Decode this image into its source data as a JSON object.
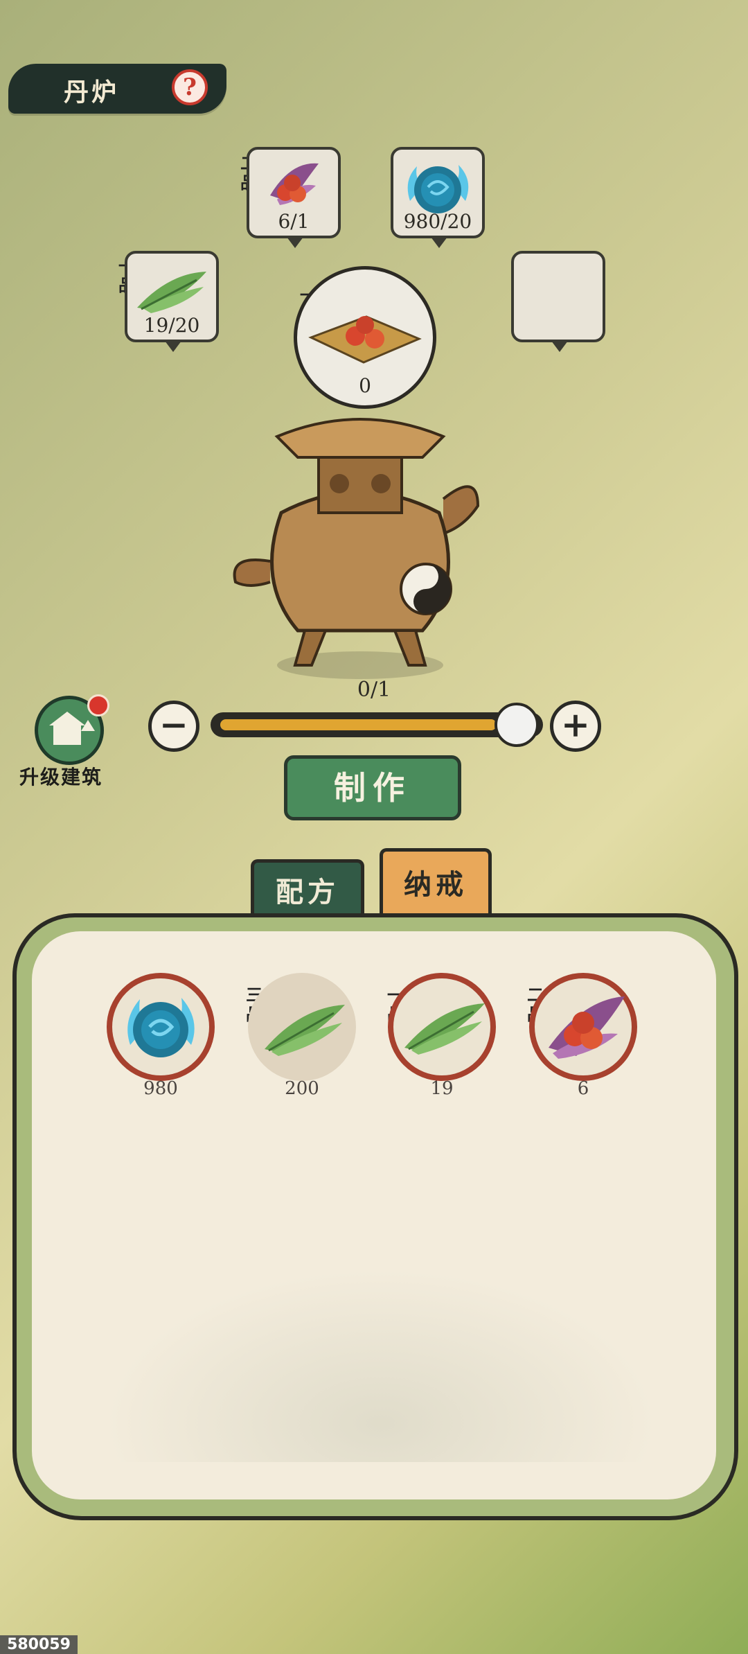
{
  "header": {
    "title": "丹炉",
    "help_icon": "?"
  },
  "ingredients": [
    {
      "grade": "二品",
      "icon": "berry-herb-icon",
      "count": "6/1"
    },
    {
      "grade": "",
      "icon": "spirit-orb-icon",
      "count": "980/20"
    },
    {
      "grade": "一品",
      "icon": "leaf-herb-icon",
      "count": "19/20"
    },
    {
      "grade": "",
      "icon": "",
      "count": ""
    }
  ],
  "product": {
    "grade": "一品",
    "icon": "pill-icon",
    "count": "0"
  },
  "progress": {
    "label": "0/1",
    "slider_fraction": 0.95
  },
  "controls": {
    "minus": "−",
    "plus": "+"
  },
  "upgrade": {
    "label": "升级建筑"
  },
  "make_button": {
    "label": "制作"
  },
  "tabs": [
    {
      "label": "配方",
      "active": false
    },
    {
      "label": "纳戒",
      "active": true
    }
  ],
  "inventory": [
    {
      "grade": "",
      "icon": "spirit-orb-icon",
      "count": "980"
    },
    {
      "grade": "三品",
      "icon": "leaf-herb-icon",
      "count": "200"
    },
    {
      "grade": "一品",
      "icon": "leaf-herb-icon",
      "count": "19"
    },
    {
      "grade": "二品",
      "icon": "berry-herb-icon",
      "count": "6"
    }
  ],
  "footer": {
    "id": "580059"
  },
  "colors": {
    "accent_green": "#4a8c5c",
    "ring_red": "#a7412e",
    "tab_orange": "#e9a85a"
  }
}
